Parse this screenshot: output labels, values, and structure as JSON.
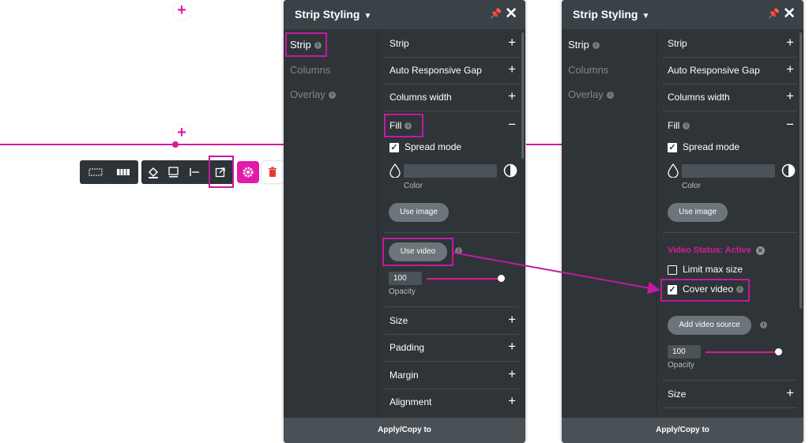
{
  "canvas": {
    "add_top": "+",
    "add_mid": "+",
    "toolbar_trash": "🗑",
    "colors": {
      "accent": "#d81b9a",
      "panel_bg": "#2f3438",
      "header_bg": "#3b4247"
    }
  },
  "left_panel": {
    "title": "Strip Styling",
    "chevron": "⌄",
    "close": "✕",
    "sidebar": {
      "strip": "Strip",
      "columns": "Columns",
      "overlay": "Overlay"
    },
    "sections": {
      "strip": "Strip",
      "auto_gap": "Auto Responsive Gap",
      "columns_width": "Columns width",
      "fill": "Fill",
      "size": "Size",
      "padding": "Padding",
      "margin": "Margin",
      "alignment": "Alignment"
    },
    "plus": "+",
    "minus": "−",
    "spread_mode": "Spread mode",
    "color_label": "Color",
    "use_image": "Use image",
    "use_video": "Use video",
    "opacity_value": "100",
    "opacity_label": "Opacity",
    "opacity_level": 1.0,
    "footer": "Apply/Copy to"
  },
  "right_panel": {
    "title": "Strip Styling",
    "chevron": "⌄",
    "close": "✕",
    "sidebar": {
      "strip": "Strip",
      "columns": "Columns",
      "overlay": "Overlay"
    },
    "sections": {
      "strip": "Strip",
      "auto_gap": "Auto Responsive Gap",
      "columns_width": "Columns width",
      "fill": "Fill",
      "size": "Size"
    },
    "plus": "+",
    "minus": "−",
    "spread_mode": "Spread mode",
    "color_label": "Color",
    "use_image": "Use image",
    "video_status": "Video Status: Active",
    "limit_max_size": "Limit max size",
    "cover_video": "Cover video",
    "add_video_source": "Add video source",
    "opacity_value": "100",
    "opacity_label": "Opacity",
    "opacity_level": 1.0,
    "footer": "Apply/Copy to"
  }
}
